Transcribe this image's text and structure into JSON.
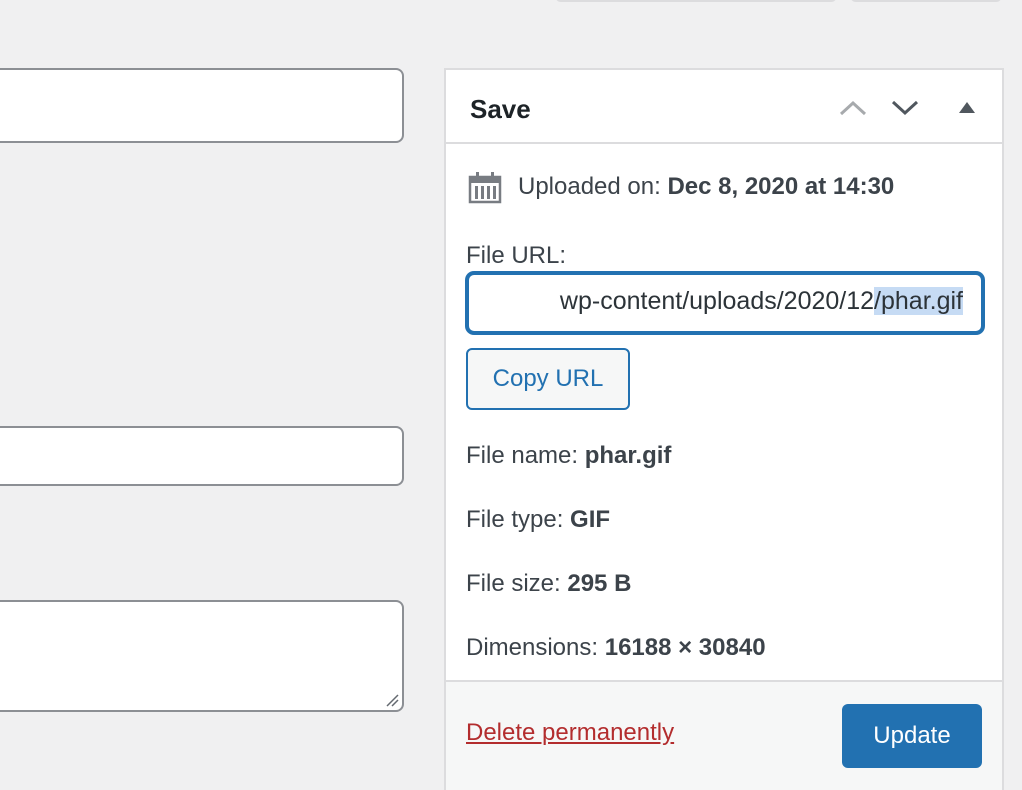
{
  "panel": {
    "title": "Save",
    "icons": {
      "move_up": "chevron-up-icon",
      "move_down": "chevron-down-icon",
      "toggle": "triangle-up-icon",
      "calendar": "calendar-icon"
    },
    "uploaded_label": "Uploaded on:",
    "uploaded_value": "Dec 8, 2020 at 14:30",
    "file_url_label": "File URL:",
    "file_url_visible_start": "wp-content/uploads/2020/12",
    "file_url_visible_selected": "/phar.gif",
    "copy_url_label": "Copy URL",
    "file_name_label": "File name:",
    "file_name_value": "phar.gif",
    "file_type_label": "File type:",
    "file_type_value": "GIF",
    "file_size_label": "File size:",
    "file_size_value": "295 B",
    "dimensions_label": "Dimensions:",
    "dimensions_value": "16188 × 30840",
    "delete_label": "Delete permanently",
    "update_label": "Update"
  },
  "colors": {
    "accent": "#2271b1",
    "danger": "#b32d2e",
    "background": "#f0f0f1"
  }
}
